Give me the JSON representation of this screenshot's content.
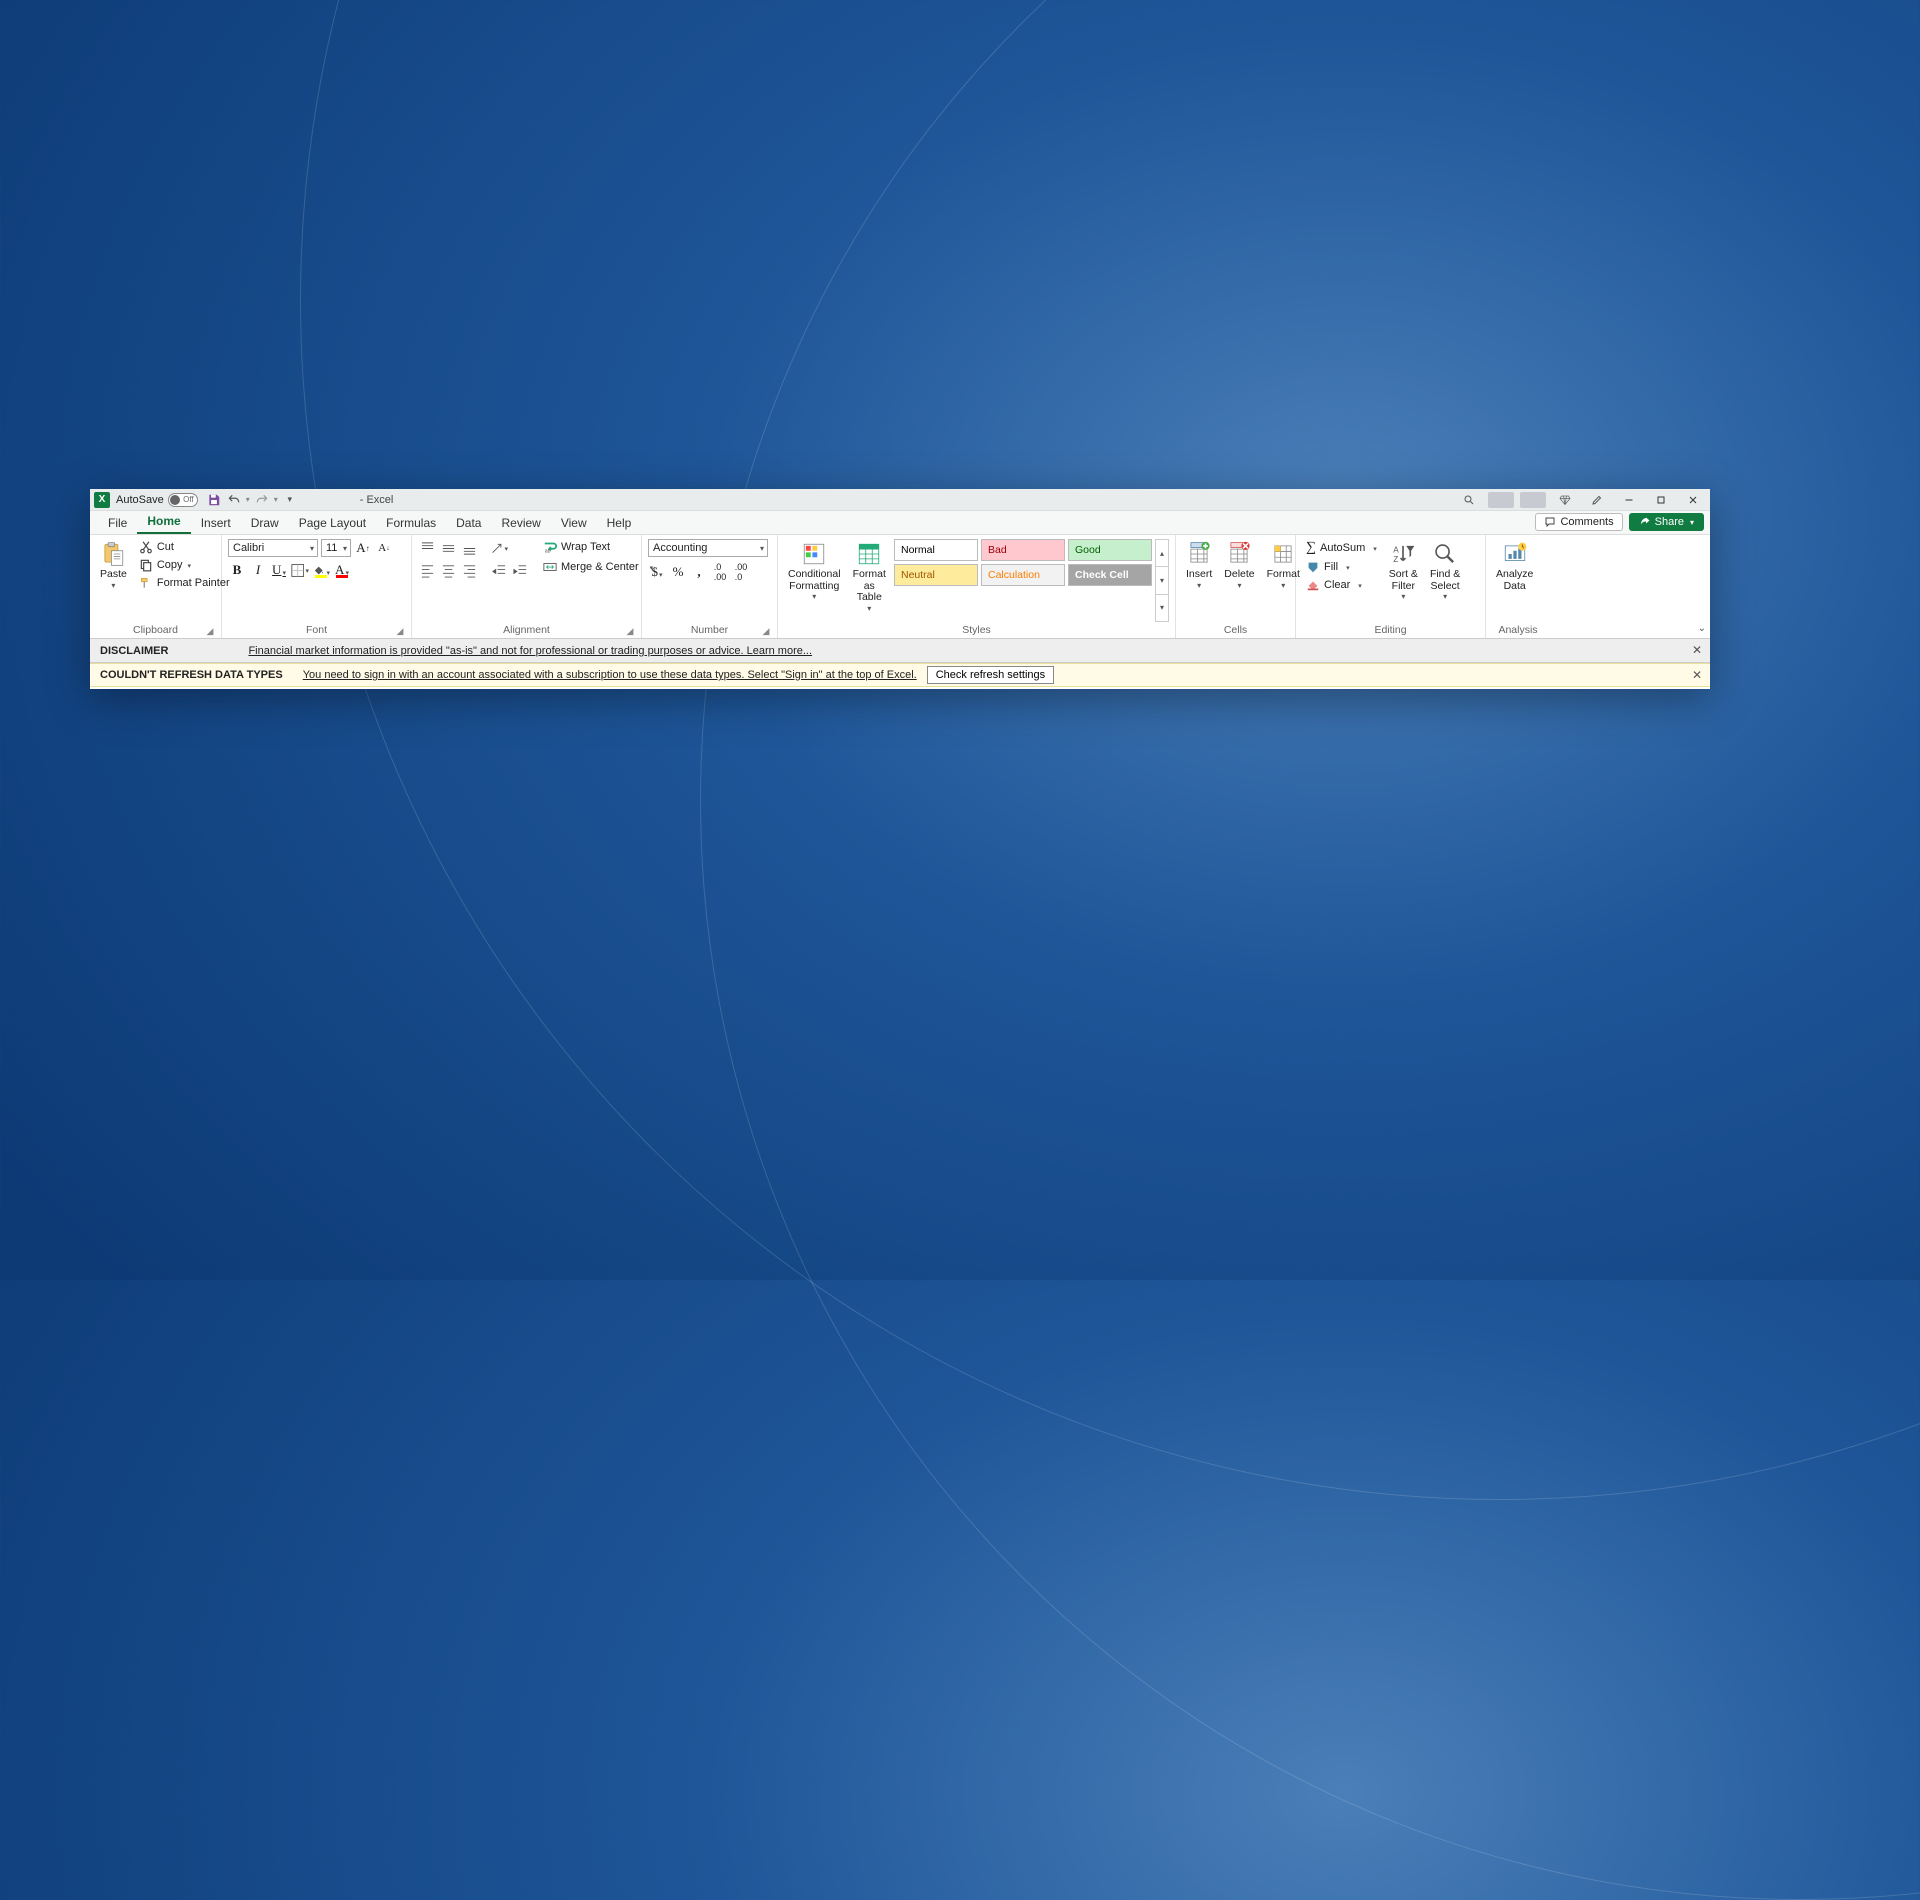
{
  "titlebar": {
    "autosave_label": "AutoSave",
    "autosave_state": "Off",
    "doc_title": "-  Excel"
  },
  "tabs": {
    "file": "File",
    "home": "Home",
    "insert": "Insert",
    "draw": "Draw",
    "page_layout": "Page Layout",
    "formulas": "Formulas",
    "data": "Data",
    "review": "Review",
    "view": "View",
    "help": "Help",
    "comments": "Comments",
    "share": "Share"
  },
  "clipboard": {
    "paste": "Paste",
    "cut": "Cut",
    "copy": "Copy",
    "fp": "Format Painter",
    "label": "Clipboard"
  },
  "font": {
    "name": "Calibri",
    "size": "11",
    "label": "Font"
  },
  "alignment": {
    "wrap": "Wrap Text",
    "merge": "Merge & Center",
    "label": "Alignment"
  },
  "number": {
    "format": "Accounting",
    "label": "Number"
  },
  "styles": {
    "cond": "Conditional Formatting",
    "fat": "Format as Table",
    "g": [
      "Normal",
      "Bad",
      "Good",
      "Neutral",
      "Calculation",
      "Check Cell"
    ],
    "label": "Styles",
    "colors": {
      "Normal": {
        "bg": "#ffffff",
        "fg": "#000000"
      },
      "Bad": {
        "bg": "#ffc7ce",
        "fg": "#9c0006"
      },
      "Good": {
        "bg": "#c6efce",
        "fg": "#006100"
      },
      "Neutral": {
        "bg": "#ffeb9c",
        "fg": "#9c5700"
      },
      "Calculation": {
        "bg": "#f2f2f2",
        "fg": "#fa7d00"
      },
      "Check Cell": {
        "bg": "#a5a5a5",
        "fg": "#ffffff"
      }
    }
  },
  "cells": {
    "insert": "Insert",
    "delete": "Delete",
    "format": "Format",
    "label": "Cells"
  },
  "editing": {
    "autosum": "AutoSum",
    "fill": "Fill",
    "clear": "Clear",
    "sort": "Sort & Filter",
    "find": "Find & Select",
    "label": "Editing"
  },
  "analysis": {
    "analyze": "Analyze Data",
    "label": "Analysis"
  },
  "msg1": {
    "title": "DISCLAIMER",
    "text": "Financial market information is provided \"as-is\" and not for professional or trading purposes or advice. Learn more..."
  },
  "msg2": {
    "title": "COULDN'T REFRESH DATA TYPES",
    "text": "You need to sign in with an account associated with a subscription to use these data types. Select \"Sign in\" at the top of Excel.",
    "btn": "Check refresh settings"
  }
}
